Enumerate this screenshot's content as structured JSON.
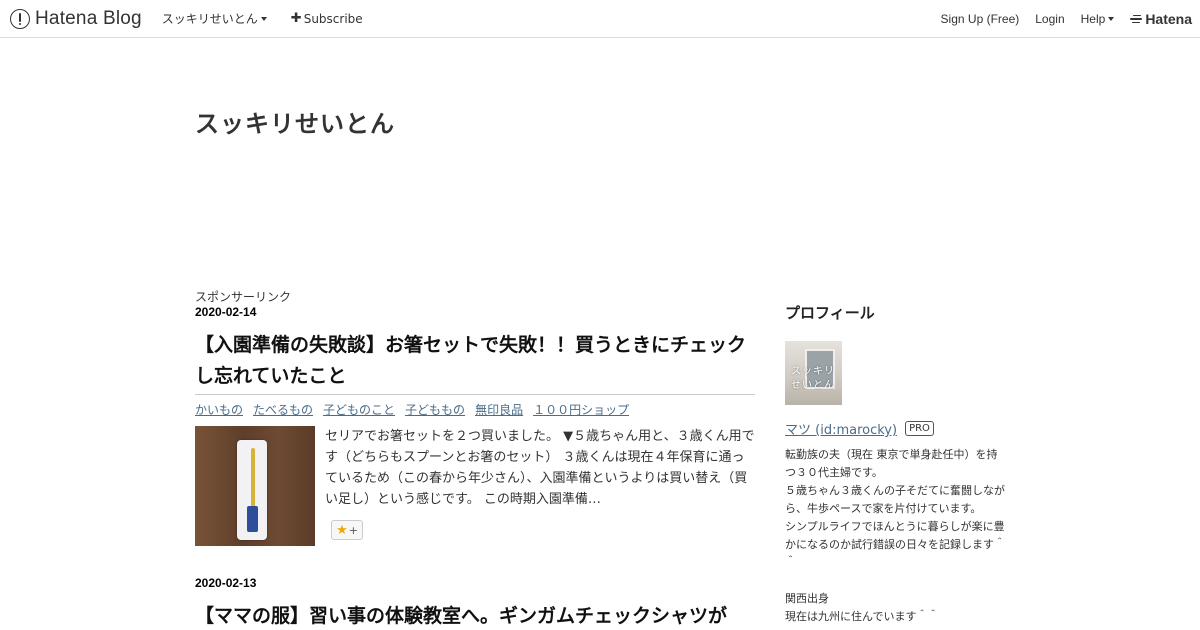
{
  "header": {
    "logo_text": "Hatena Blog",
    "blog_menu": "スッキリせいとん",
    "subscribe": "Subscribe",
    "signup": "Sign Up (Free)",
    "login": "Login",
    "help": "Help",
    "brand": "Hatena"
  },
  "blog": {
    "title": "スッキリせいとん"
  },
  "main": {
    "sponsor_label": "スポンサーリンク",
    "entries": [
      {
        "date": "2020-02-14",
        "title": "【入園準備の失敗談】お箸セットで失敗！！買うときにチェックし忘れていたこと",
        "categories": [
          "かいもの",
          "たべるもの",
          "子どものこと",
          "子どももの",
          "無印良品",
          "１００円ショップ"
        ],
        "excerpt": "セリアでお箸セットを２つ買いました。 ▼５歳ちゃん用と、３歳くん用です（どちらもスプーンとお箸のセット） ３歳くんは現在４年保育に通っているため（この春から年少さん）、入園準備というよりは買い替え（買い足し）という感じです。 この時期入園準備…",
        "star_button": "+"
      },
      {
        "date": "2020-02-13",
        "title": "【ママの服】習い事の体験教室へ。ギンガムチェックシャツが"
      }
    ]
  },
  "sidebar": {
    "profile_title": "プロフィール",
    "profile_icon_text": "スッキリ\nせいとん",
    "profile_name": "マツ (id:marocky)",
    "pro_badge": "PRO",
    "description": "転勤族の夫（現在 東京で単身赴任中）を持つ３０代主婦です。\n５歳ちゃん３歳くんの子そだてに奮闘しながら、牛歩ペースで家を片付けています。\nシンプルライフでほんとうに暮らしが楽に豊かになるのか試行錯誤の日々を記録します＾＾\n\n関西出身\n現在は九州に住んでいます＾＾"
  }
}
